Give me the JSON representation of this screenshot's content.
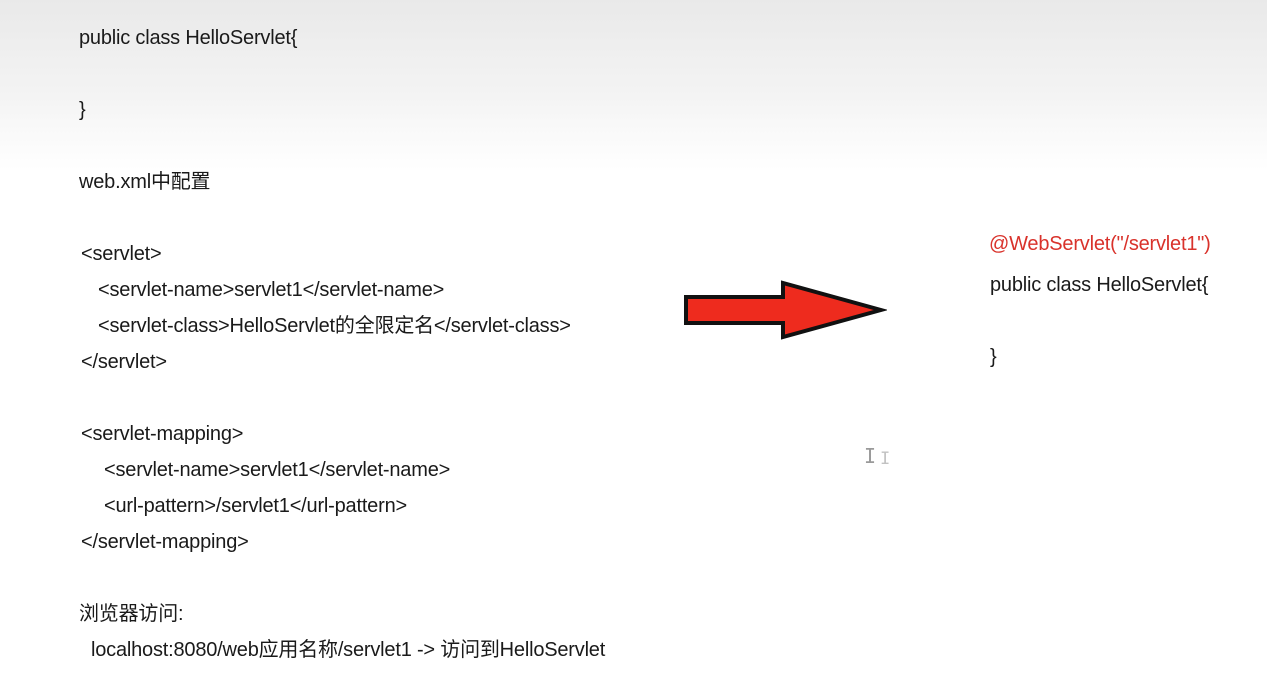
{
  "left": {
    "class_decl": "public class HelloServlet{",
    "class_close": "}",
    "config_heading": "web.xml中配置",
    "servlet_open": "<servlet>",
    "servlet_name": "<servlet-name>servlet1</servlet-name>",
    "servlet_class": "<servlet-class>HelloServlet的全限定名</servlet-class>",
    "servlet_close": "</servlet>",
    "mapping_open": "<servlet-mapping>",
    "mapping_name": "<servlet-name>servlet1</servlet-name>",
    "url_pattern": "<url-pattern>/servlet1</url-pattern>",
    "mapping_close": "</servlet-mapping>",
    "browser_heading": "浏览器访问:",
    "browser_url": "localhost:8080/web应用名称/servlet1 -> 访问到HelloServlet"
  },
  "right": {
    "annotation": "@WebServlet(\"/servlet1\")",
    "class_decl": "public class HelloServlet{",
    "class_close": "}"
  },
  "colors": {
    "annotation": "#d9322b",
    "arrow_fill": "#ee2b1e",
    "arrow_stroke": "#111111"
  },
  "icons": {
    "arrow": "right-arrow-icon",
    "cursor": "text-cursor-icon"
  }
}
